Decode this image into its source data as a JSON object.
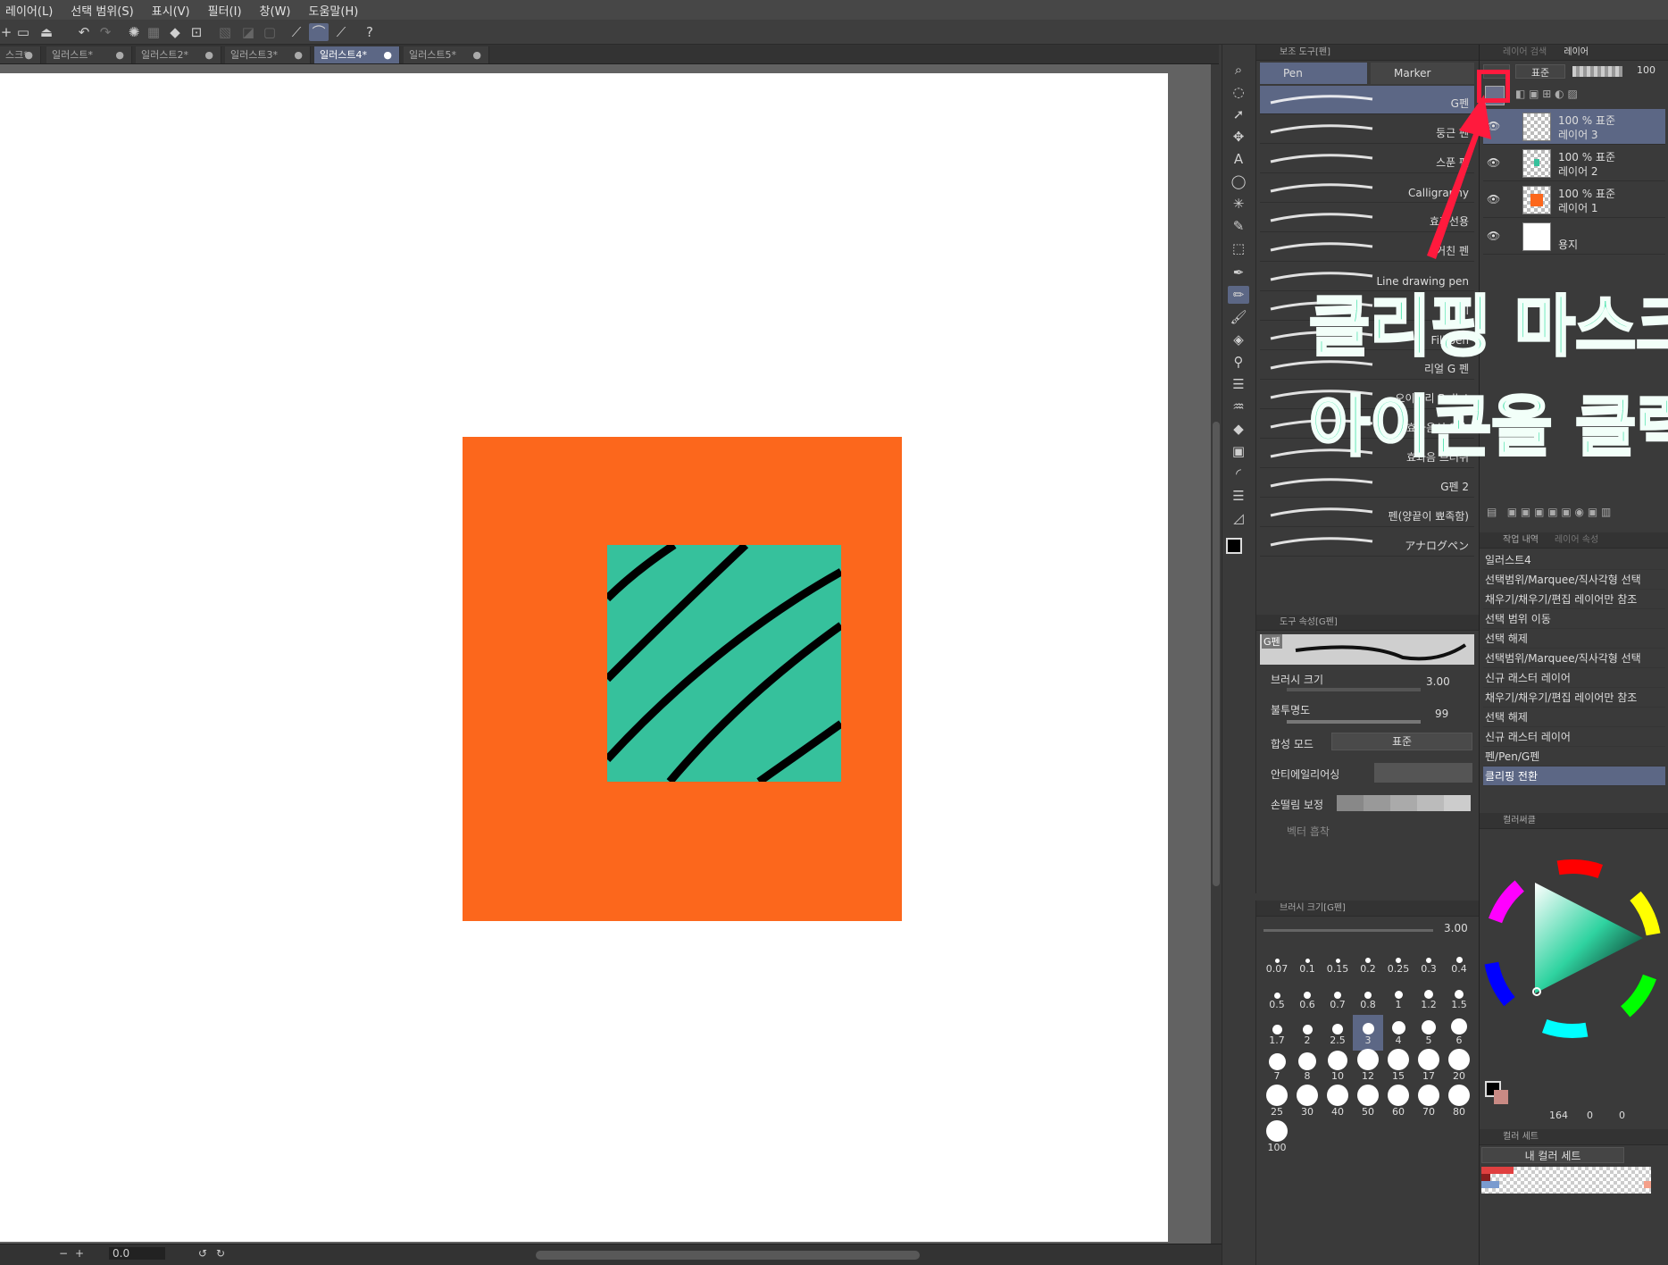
{
  "menu": [
    "레이어(L)",
    "선택 범위(S)",
    "표시(V)",
    "필터(I)",
    "창(W)",
    "도움말(H)"
  ],
  "tabs": [
    {
      "label": "스크*",
      "active": false
    },
    {
      "label": "일러스트*",
      "active": false
    },
    {
      "label": "일러스트2*",
      "active": false
    },
    {
      "label": "일러스트3*",
      "active": false
    },
    {
      "label": "일러스트4*",
      "active": true
    },
    {
      "label": "일러스트5*",
      "active": false
    }
  ],
  "status": {
    "zoom": "0.0"
  },
  "subtool": {
    "title": "보조 도구[펜]",
    "tab_pen": "Pen",
    "tab_marker": "Marker",
    "brushes": [
      "G펜",
      "둥근 펜",
      "스푼 펜",
      "Calligraphy",
      "효과선용",
      "거친 펜",
      "Line drawing pen",
      "Fill",
      "Fill pen",
      "리얼 G 펜",
      "오이타리 Bullet",
      "효과음선 연습",
      "효과음 브러쉬",
      "G펜 2",
      "펜(양끝이 뾰족함)",
      "アナログペン"
    ]
  },
  "tool_property": {
    "title": "도구 속성[G펜]",
    "tool_name": "G펜",
    "brush_size_label": "브러시 크기",
    "brush_size_value": "3.00",
    "opacity_label": "불투명도",
    "opacity_value": "99",
    "blend_label": "합성 모드",
    "blend_value": "표준",
    "antialias_label": "안티에일리어싱",
    "stabilization_label": "손떨림 보정",
    "vector_label": "벡터 흡착"
  },
  "brush_size_panel": {
    "title": "브러시 크기[G펜]",
    "value": "3.00",
    "sizes": [
      "0.07",
      "0.1",
      "0.15",
      "0.2",
      "0.25",
      "0.3",
      "0.4",
      "0.5",
      "0.6",
      "0.7",
      "0.8",
      "1",
      "1.2",
      "1.5",
      "1.7",
      "2",
      "2.5",
      "3",
      "4",
      "5",
      "6",
      "7",
      "8",
      "10",
      "12",
      "15",
      "17",
      "20",
      "25",
      "30",
      "40",
      "50",
      "60",
      "70",
      "80",
      "100"
    ],
    "selected": "3"
  },
  "layer_panel": {
    "tab_color": "레이어 검색",
    "tab_layer": "레이어",
    "blend": "표준",
    "opacity": "100",
    "layers": [
      {
        "pct": "100 % 표준",
        "name": "레이어 3",
        "selected": true,
        "thumb": "clip"
      },
      {
        "pct": "100 % 표준",
        "name": "레이어 2",
        "selected": false,
        "thumb": "teal"
      },
      {
        "pct": "100 % 표준",
        "name": "레이어 1",
        "selected": false,
        "thumb": "orange"
      },
      {
        "pct": "",
        "name": "용지",
        "selected": false,
        "thumb": "paper"
      }
    ]
  },
  "history": {
    "title": "작업 내역",
    "title2": "레이어 속성",
    "items": [
      "일러스트4",
      "선택범위/Marquee/직사각형 선택",
      "채우기/채우기/편집 레이어만 참조",
      "선택 범위 이동",
      "선택 해제",
      "선택범위/Marquee/직사각형 선택",
      "신규 래스터 레이어",
      "채우기/채우기/편집 레이어만 참조",
      "선택 해제",
      "신규 래스터 레이어",
      "펜/Pen/G펜",
      "클리핑 전환"
    ],
    "selected_index": 11
  },
  "color_circle": {
    "title": "컬러써클",
    "readout_1": "164",
    "readout_2": "0",
    "readout_3": "0"
  },
  "color_set": {
    "title": "컬러 세트",
    "set_name": "내 컬러 세트"
  },
  "annotation": {
    "line1": "클리핑 마스크",
    "line2": "아이콘을 클릭"
  },
  "colors": {
    "orange": "#fc671c",
    "teal": "#36c19c",
    "accent": "#5c6785",
    "highlight": "#ff1a3d"
  }
}
